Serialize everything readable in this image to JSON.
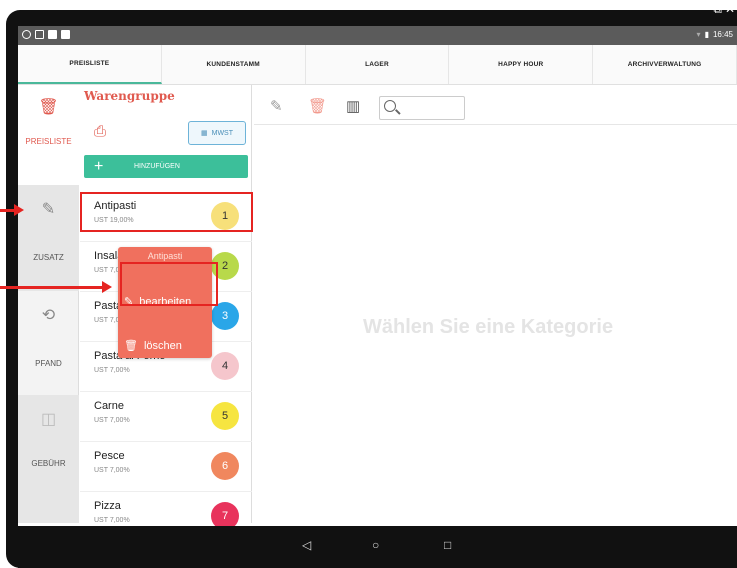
{
  "statusbar": {
    "time": "16:45"
  },
  "tabs": [
    {
      "label": "PREISLISTE"
    },
    {
      "label": "KUNDENSTAMM"
    },
    {
      "label": "LAGER"
    },
    {
      "label": "HAPPY HOUR"
    },
    {
      "label": "ARCHIVVERWALTUNG"
    }
  ],
  "rail": {
    "preisliste": "PREISLISTE",
    "zusatz": "ZUSATZ",
    "pfand": "PFAND",
    "gebuehr": "GEBÜHR"
  },
  "panel": {
    "title": "Warengruppe",
    "mwst": "MWST",
    "add": "HINZUFÜGEN"
  },
  "categories": [
    {
      "name": "Antipasti",
      "ust": "UST 19,00%",
      "num": "1",
      "color": "#f7e07a"
    },
    {
      "name": "Insalate",
      "ust": "UST 7,00%",
      "num": "2",
      "color": "#b8d94a"
    },
    {
      "name": "Pasta",
      "ust": "UST 7,00%",
      "num": "3",
      "color": "#2aa6e8"
    },
    {
      "name": "Pasta al Forno",
      "ust": "UST 7,00%",
      "num": "4",
      "color": "#f5c6cc"
    },
    {
      "name": "Carne",
      "ust": "UST 7,00%",
      "num": "5",
      "color": "#f6e540"
    },
    {
      "name": "Pesce",
      "ust": "UST 7,00%",
      "num": "6",
      "color": "#f0875e"
    },
    {
      "name": "Pizza",
      "ust": "UST 7,00%",
      "num": "7",
      "color": "#e8335c"
    }
  ],
  "popup": {
    "title": "Antipasti",
    "edit": "bearbeiten",
    "delete": "löschen"
  },
  "main": {
    "placeholder": "Wählen Sie eine Kategorie"
  },
  "icons": {
    "edit": "pencil-icon",
    "trash": "trash-icon",
    "barcode": "barcode-search-icon",
    "search": "search-icon"
  }
}
